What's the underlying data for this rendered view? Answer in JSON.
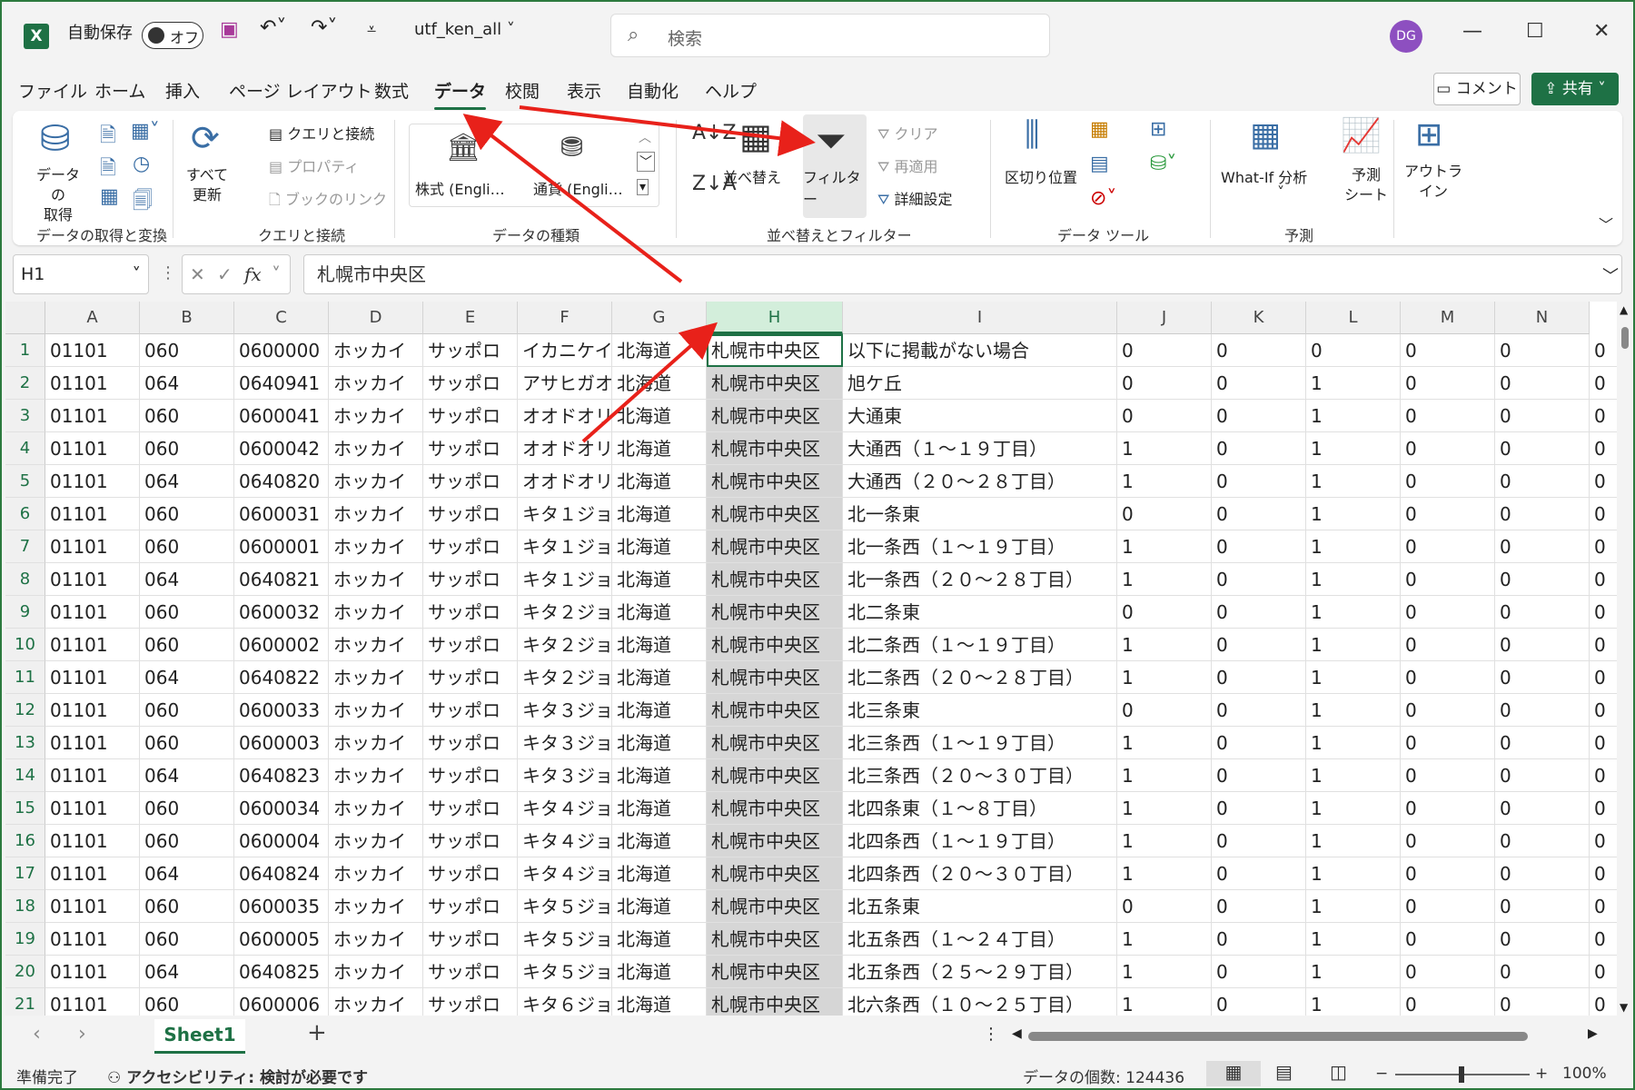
{
  "titlebar": {
    "autosave_label": "自動保存",
    "autosave_state": "オフ",
    "filename": "utf_ken_all",
    "search_placeholder": "検索",
    "user_initials": "DG"
  },
  "menu": [
    "ファイル",
    "ホーム",
    "挿入",
    "ページ レイアウト",
    "数式",
    "データ",
    "校閲",
    "表示",
    "自動化",
    "ヘルプ"
  ],
  "menu_active": "データ",
  "comment_label": "コメント",
  "share_label": "共有",
  "ribbon": {
    "get_data": "データの\n取得",
    "refresh_all": "すべて\n更新",
    "queries_connections": "クエリと接続",
    "properties": "プロパティ",
    "edit_links": "ブックのリンク",
    "stocks": "株式 (Engli…",
    "currencies": "通貨 (Engli…",
    "sort": "並べ替え",
    "filter": "フィルター",
    "clear": "クリア",
    "reapply": "再適用",
    "advanced": "詳細設定",
    "text_to_columns": "区切り位置",
    "whatif": "What-If 分析",
    "forecast_sheet": "予測\nシート",
    "outline": "アウトラ\nイン",
    "groups": [
      "データの取得と変換",
      "クエリと接続",
      "データの種類",
      "並べ替えとフィルター",
      "データ ツール",
      "予測"
    ]
  },
  "formula": {
    "namebox": "H1",
    "content": "札幌市中央区"
  },
  "columns": [
    "A",
    "B",
    "C",
    "D",
    "E",
    "F",
    "G",
    "H",
    "I",
    "J",
    "K",
    "L",
    "M",
    "N"
  ],
  "selected_column": "H",
  "rows": [
    [
      "01101",
      "060",
      "0600000",
      "ホッカイ",
      "サッポロ",
      "イカニケイ",
      "北海道",
      "札幌市中央区",
      "以下に掲載がない場合",
      "0",
      "0",
      "0",
      "0",
      "0",
      "0"
    ],
    [
      "01101",
      "064",
      "0640941",
      "ホッカイ",
      "サッポロ",
      "アサヒガオ",
      "北海道",
      "札幌市中央区",
      "旭ケ丘",
      "0",
      "0",
      "1",
      "0",
      "0",
      "0"
    ],
    [
      "01101",
      "060",
      "0600041",
      "ホッカイ",
      "サッポロ",
      "オオドオリ",
      "北海道",
      "札幌市中央区",
      "大通東",
      "0",
      "0",
      "1",
      "0",
      "0",
      "0"
    ],
    [
      "01101",
      "060",
      "0600042",
      "ホッカイ",
      "サッポロ",
      "オオドオリ",
      "北海道",
      "札幌市中央区",
      "大通西（１～１９丁目）",
      "1",
      "0",
      "1",
      "0",
      "0",
      "0"
    ],
    [
      "01101",
      "064",
      "0640820",
      "ホッカイ",
      "サッポロ",
      "オオドオリ",
      "北海道",
      "札幌市中央区",
      "大通西（２０～２８丁目）",
      "1",
      "0",
      "1",
      "0",
      "0",
      "0"
    ],
    [
      "01101",
      "060",
      "0600031",
      "ホッカイ",
      "サッポロ",
      "キタ１ジョ",
      "北海道",
      "札幌市中央区",
      "北一条東",
      "0",
      "0",
      "1",
      "0",
      "0",
      "0"
    ],
    [
      "01101",
      "060",
      "0600001",
      "ホッカイ",
      "サッポロ",
      "キタ１ジョ",
      "北海道",
      "札幌市中央区",
      "北一条西（１～１９丁目）",
      "1",
      "0",
      "1",
      "0",
      "0",
      "0"
    ],
    [
      "01101",
      "064",
      "0640821",
      "ホッカイ",
      "サッポロ",
      "キタ１ジョ",
      "北海道",
      "札幌市中央区",
      "北一条西（２０～２８丁目）",
      "1",
      "0",
      "1",
      "0",
      "0",
      "0"
    ],
    [
      "01101",
      "060",
      "0600032",
      "ホッカイ",
      "サッポロ",
      "キタ２ジョ",
      "北海道",
      "札幌市中央区",
      "北二条東",
      "0",
      "0",
      "1",
      "0",
      "0",
      "0"
    ],
    [
      "01101",
      "060",
      "0600002",
      "ホッカイ",
      "サッポロ",
      "キタ２ジョ",
      "北海道",
      "札幌市中央区",
      "北二条西（１～１９丁目）",
      "1",
      "0",
      "1",
      "0",
      "0",
      "0"
    ],
    [
      "01101",
      "064",
      "0640822",
      "ホッカイ",
      "サッポロ",
      "キタ２ジョ",
      "北海道",
      "札幌市中央区",
      "北二条西（２０～２８丁目）",
      "1",
      "0",
      "1",
      "0",
      "0",
      "0"
    ],
    [
      "01101",
      "060",
      "0600033",
      "ホッカイ",
      "サッポロ",
      "キタ３ジョ",
      "北海道",
      "札幌市中央区",
      "北三条東",
      "0",
      "0",
      "1",
      "0",
      "0",
      "0"
    ],
    [
      "01101",
      "060",
      "0600003",
      "ホッカイ",
      "サッポロ",
      "キタ３ジョ",
      "北海道",
      "札幌市中央区",
      "北三条西（１～１９丁目）",
      "1",
      "0",
      "1",
      "0",
      "0",
      "0"
    ],
    [
      "01101",
      "064",
      "0640823",
      "ホッカイ",
      "サッポロ",
      "キタ３ジョ",
      "北海道",
      "札幌市中央区",
      "北三条西（２０～３０丁目）",
      "1",
      "0",
      "1",
      "0",
      "0",
      "0"
    ],
    [
      "01101",
      "060",
      "0600034",
      "ホッカイ",
      "サッポロ",
      "キタ４ジョ",
      "北海道",
      "札幌市中央区",
      "北四条東（１～８丁目）",
      "1",
      "0",
      "1",
      "0",
      "0",
      "0"
    ],
    [
      "01101",
      "060",
      "0600004",
      "ホッカイ",
      "サッポロ",
      "キタ４ジョ",
      "北海道",
      "札幌市中央区",
      "北四条西（１～１９丁目）",
      "1",
      "0",
      "1",
      "0",
      "0",
      "0"
    ],
    [
      "01101",
      "064",
      "0640824",
      "ホッカイ",
      "サッポロ",
      "キタ４ジョ",
      "北海道",
      "札幌市中央区",
      "北四条西（２０～３０丁目）",
      "1",
      "0",
      "1",
      "0",
      "0",
      "0"
    ],
    [
      "01101",
      "060",
      "0600035",
      "ホッカイ",
      "サッポロ",
      "キタ５ジョ",
      "北海道",
      "札幌市中央区",
      "北五条東",
      "0",
      "0",
      "1",
      "0",
      "0",
      "0"
    ],
    [
      "01101",
      "060",
      "0600005",
      "ホッカイ",
      "サッポロ",
      "キタ５ジョ",
      "北海道",
      "札幌市中央区",
      "北五条西（１～２４丁目）",
      "1",
      "0",
      "1",
      "0",
      "0",
      "0"
    ],
    [
      "01101",
      "064",
      "0640825",
      "ホッカイ",
      "サッポロ",
      "キタ５ジョ",
      "北海道",
      "札幌市中央区",
      "北五条西（２５～２９丁目）",
      "1",
      "0",
      "1",
      "0",
      "0",
      "0"
    ],
    [
      "01101",
      "060",
      "0600006",
      "ホッカイ",
      "サッポロ",
      "キタ６ジョ",
      "北海道",
      "札幌市中央区",
      "北六条西（１０～２５丁目）",
      "1",
      "0",
      "1",
      "0",
      "0",
      "0"
    ]
  ],
  "sheet_tab": "Sheet1",
  "status": {
    "ready": "準備完了",
    "accessibility": "アクセシビリティ: 検討が必要です",
    "count": "データの個数: 124436",
    "zoom": "100%"
  }
}
